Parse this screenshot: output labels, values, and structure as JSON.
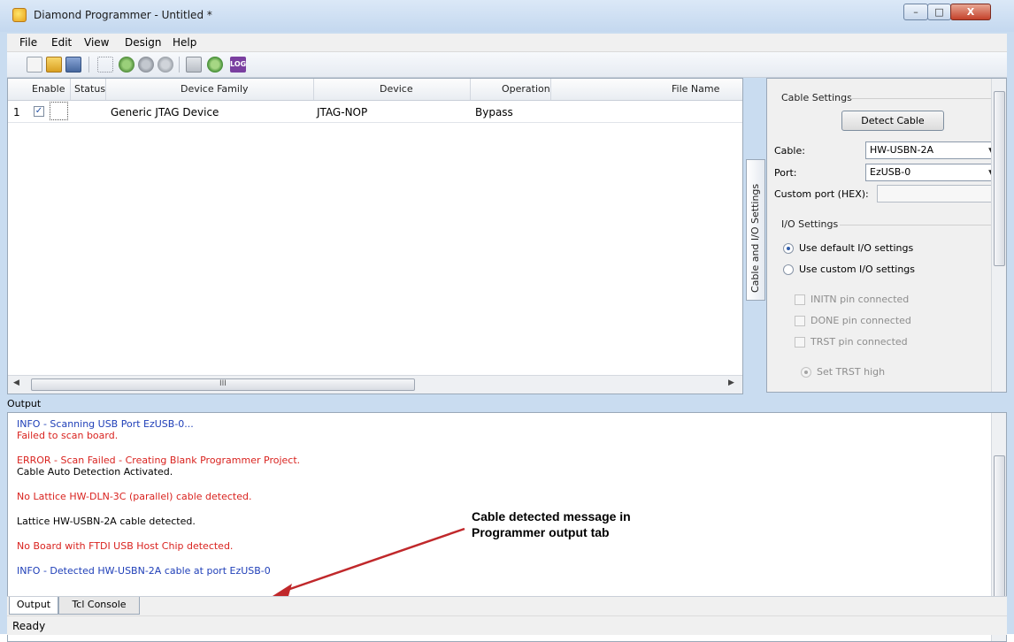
{
  "window": {
    "title": "Diamond Programmer - Untitled *",
    "controls": {
      "minimize": "–",
      "maximize": "□",
      "close": "X"
    }
  },
  "menu": [
    "File",
    "Edit",
    "View",
    "Design",
    "Help"
  ],
  "toolbar": {
    "icons": [
      "new-project-icon",
      "open-project-icon",
      "save-icon",
      "scan-chain-icon",
      "program-device-icon",
      "operation-icon",
      "settings-gear-icon",
      "device-properties-icon",
      "download-icon",
      "log-icon"
    ],
    "log_label": "LOG"
  },
  "grid": {
    "columns": [
      "Enable",
      "Status",
      "Device Family",
      "Device",
      "Operation",
      "File Name"
    ],
    "rows": [
      {
        "index": "1",
        "enabled": true,
        "status": "",
        "family": "Generic JTAG Device",
        "device": "JTAG-NOP",
        "operation": "Bypass",
        "file": ""
      }
    ],
    "scroll_grip": "III"
  },
  "side_tab": {
    "label": "Cable and I/O Settings"
  },
  "cable_settings": {
    "title": "Cable Settings",
    "detect_button": "Detect Cable",
    "cable_label": "Cable:",
    "cable_value": "HW-USBN-2A",
    "port_label": "Port:",
    "port_value": "EzUSB-0",
    "custom_port_label": "Custom port (HEX):",
    "custom_port_value": ""
  },
  "io_settings": {
    "title": "I/O Settings",
    "options": [
      {
        "label": "Use default I/O settings",
        "selected": true
      },
      {
        "label": "Use custom I/O settings",
        "selected": false
      }
    ],
    "pins": [
      {
        "label": "INITN pin connected",
        "checked": false
      },
      {
        "label": "DONE pin connected",
        "checked": false
      },
      {
        "label": "TRST pin connected",
        "checked": false
      }
    ],
    "trst_option": "Set TRST high"
  },
  "output": {
    "label": "Output",
    "lines": [
      {
        "text": "INFO - Scanning USB Port EzUSB-0...",
        "color": "#1f3fb8"
      },
      {
        "text": "Failed to scan board.",
        "color": "#d9231f"
      },
      {
        "text": "ERROR - Scan Failed - Creating Blank Programmer Project.",
        "color": "#d9231f"
      },
      {
        "text": "Cable Auto Detection Activated.",
        "color": "#000000"
      },
      {
        "text": "No Lattice HW-DLN-3C (parallel) cable detected.",
        "color": "#d9231f"
      },
      {
        "text": "Lattice HW-USBN-2A cable detected.",
        "color": "#000000"
      },
      {
        "text": "No Board with FTDI USB Host Chip detected.",
        "color": "#d9231f"
      },
      {
        "text": "INFO - Detected HW-USBN-2A cable at port EzUSB-0",
        "color": "#1f3fb8"
      }
    ]
  },
  "annotation": {
    "line1": "Cable detected message in",
    "line2": "Programmer output tab",
    "arrow_color": "#c0282b"
  },
  "bottom_tabs": [
    "Output",
    "Tcl Console"
  ],
  "status": "Ready"
}
